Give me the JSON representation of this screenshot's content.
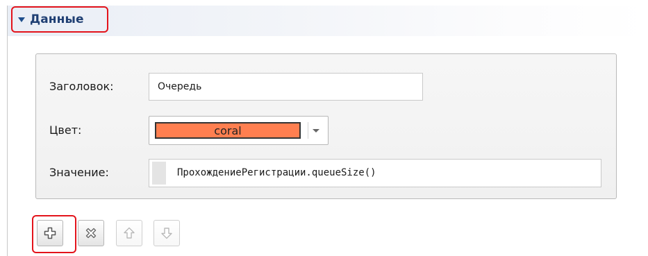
{
  "section": {
    "title": "Данные",
    "expanded": true,
    "toggle_icon": "triangle-down-icon"
  },
  "form": {
    "title_label": "Заголовок:",
    "title_value": "Очередь",
    "color_label": "Цвет:",
    "color_value": "coral",
    "color_swatch": "#FF7F50",
    "value_label": "Значение:",
    "value_expression": "ПрохождениеРегистрации.queueSize()"
  },
  "toolbar": {
    "buttons": [
      {
        "icon": "add-icon",
        "enabled": true
      },
      {
        "icon": "delete-icon",
        "enabled": true
      },
      {
        "icon": "move-up-icon",
        "enabled": false
      },
      {
        "icon": "move-down-icon",
        "enabled": false
      }
    ]
  },
  "colors": {
    "highlight": "#E3131B",
    "section_title": "#1F3F73"
  }
}
